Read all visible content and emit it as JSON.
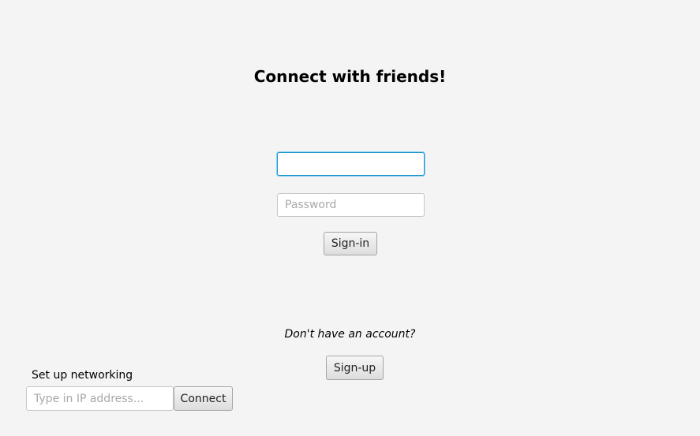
{
  "login": {
    "title": "Connect with friends!",
    "username_value": "",
    "password_placeholder": "Password",
    "signin_label": "Sign-in"
  },
  "signup": {
    "prompt": "Don't have an account?",
    "signup_label": "Sign-up"
  },
  "networking": {
    "label": "Set up networking",
    "ip_placeholder": "Type in IP address...",
    "connect_label": "Connect"
  }
}
